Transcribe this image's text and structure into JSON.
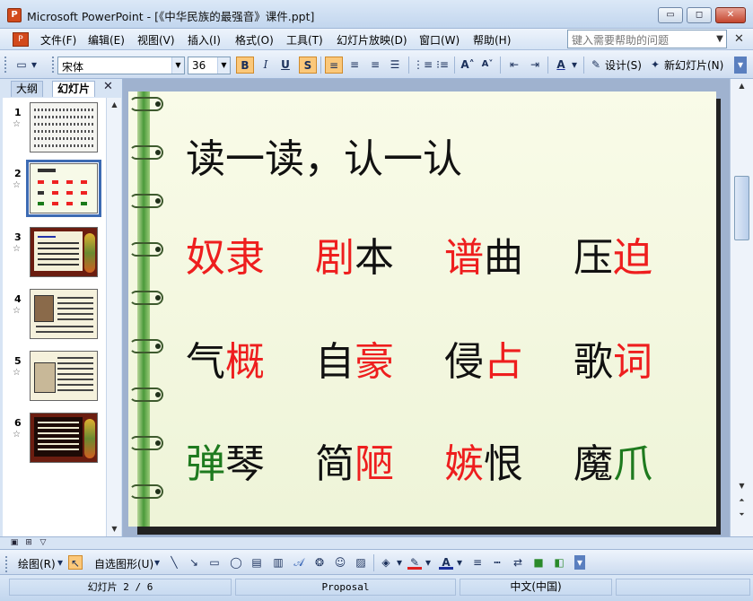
{
  "window": {
    "title": "Microsoft PowerPoint - [《中华民族的最强音》课件.ppt]",
    "app_icon": "P",
    "buttons": {
      "minimize": "▭",
      "restore": "◻",
      "close": "✕"
    }
  },
  "menu": {
    "items": [
      "文件(F)",
      "编辑(E)",
      "视图(V)",
      "插入(I)",
      "格式(O)",
      "工具(T)",
      "幻灯片放映(D)",
      "窗口(W)",
      "帮助(H)"
    ],
    "help_placeholder": "键入需要帮助的问题",
    "close_doc": "✕"
  },
  "format_toolbar": {
    "font": "宋体",
    "size": "36",
    "bold": "B",
    "italic": "I",
    "underline": "U",
    "shadow": "S",
    "design_label": "设计(S)",
    "new_slide_label": "新幻灯片(N)"
  },
  "outline_panel": {
    "tabs": [
      "大纲",
      "幻灯片"
    ],
    "active_tab": "幻灯片",
    "close": "✕",
    "slides": [
      {
        "num": "1",
        "star": "☆"
      },
      {
        "num": "2",
        "star": "☆",
        "selected": true
      },
      {
        "num": "3",
        "star": "☆"
      },
      {
        "num": "4",
        "star": "☆"
      },
      {
        "num": "5",
        "star": "☆"
      },
      {
        "num": "6",
        "star": "☆"
      }
    ]
  },
  "slide": {
    "title": "读一读，认一认",
    "rows": [
      [
        [
          {
            "t": "奴隶",
            "c": "red"
          }
        ],
        [
          {
            "t": "剧",
            "c": "red"
          },
          {
            "t": "本",
            "c": "black"
          }
        ],
        [
          {
            "t": "谱",
            "c": "red"
          },
          {
            "t": "曲",
            "c": "black"
          }
        ],
        [
          {
            "t": "压",
            "c": "black"
          },
          {
            "t": "迫",
            "c": "red"
          }
        ]
      ],
      [
        [
          {
            "t": "气",
            "c": "black"
          },
          {
            "t": "概",
            "c": "red"
          }
        ],
        [
          {
            "t": "自",
            "c": "black"
          },
          {
            "t": "豪",
            "c": "red"
          }
        ],
        [
          {
            "t": "侵",
            "c": "black"
          },
          {
            "t": "占",
            "c": "red"
          }
        ],
        [
          {
            "t": "歌",
            "c": "black"
          },
          {
            "t": "词",
            "c": "red"
          }
        ]
      ],
      [
        [
          {
            "t": "弹",
            "c": "green"
          },
          {
            "t": "琴",
            "c": "black"
          }
        ],
        [
          {
            "t": "简",
            "c": "black"
          },
          {
            "t": "陋",
            "c": "red"
          }
        ],
        [
          {
            "t": "嫉",
            "c": "red"
          },
          {
            "t": "恨",
            "c": "black"
          }
        ],
        [
          {
            "t": "魔",
            "c": "black"
          },
          {
            "t": "爪",
            "c": "green"
          }
        ]
      ]
    ],
    "colors": {
      "red": "#ee1e1e",
      "black": "#111111",
      "green": "#1e7a1e"
    }
  },
  "drawing_toolbar": {
    "draw_label": "绘图(R)",
    "autoshapes_label": "自选图形(U)"
  },
  "status": {
    "slide": "幻灯片 2 / 6",
    "design": "Proposal",
    "language": "中文(中国)"
  }
}
